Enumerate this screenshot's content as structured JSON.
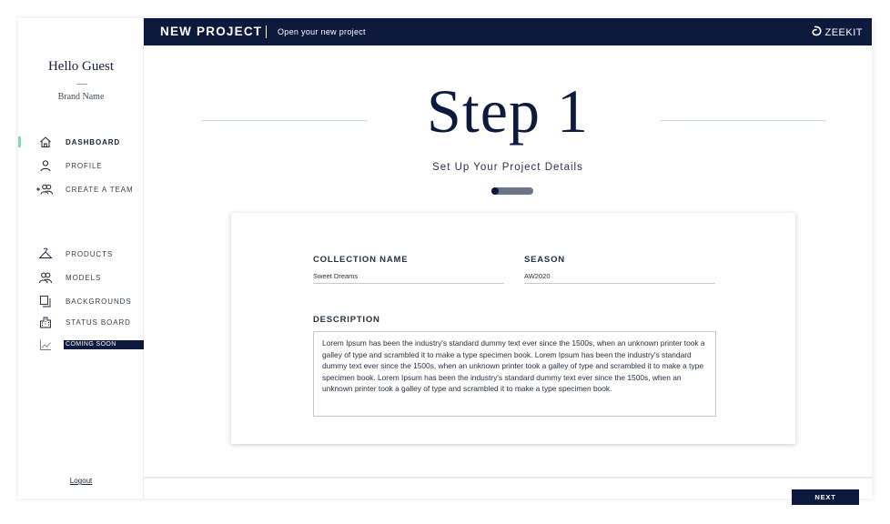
{
  "sidebar": {
    "greeting": "Hello Guest",
    "brand": "Brand Name",
    "nav_primary": [
      {
        "label": "DASHBOARD",
        "icon": "home-icon",
        "active": true
      },
      {
        "label": "PROFILE",
        "icon": "user-icon",
        "active": false
      },
      {
        "label": "CREATE A TEAM",
        "icon": "add-team-icon",
        "active": false
      }
    ],
    "nav_secondary": [
      {
        "label": "PRODUCTS",
        "icon": "hanger-icon"
      },
      {
        "label": "MODELS",
        "icon": "models-icon"
      },
      {
        "label": "BACKGROUNDS",
        "icon": "layers-icon"
      },
      {
        "label": "STATUS BOARD",
        "icon": "buildings-icon"
      },
      {
        "label": "COMING SOON",
        "icon": "chart-icon"
      }
    ],
    "logout": "Logout"
  },
  "topbar": {
    "title": "NEW PROJECT",
    "subtitle": "Open your new project",
    "logo": "ZEEKIT"
  },
  "main": {
    "step_heading": "Step 1",
    "step_subtitle": "Set Up Your Project Details",
    "progress": 0.18,
    "form": {
      "collection_label": "COLLECTION NAME",
      "collection_value": "Sweet Dreams",
      "season_label": "SEASON",
      "season_value": "AW2020",
      "description_label": "DESCRIPTION",
      "description_value": "Lorem Ipsum has been the industry's standard dummy text ever since the 1500s, when an unknown printer took a galley of type and scrambled it to make a type specimen book. Lorem Ipsum has been the industry's standard dummy text ever since the 1500s, when an unknown printer took a galley of type and scrambled it to make a type specimen book. Lorem Ipsum has been the industry's standard dummy text ever since the 1500s, when an unknown printer took a galley of type and scrambled it to make a type specimen book."
    },
    "next_label": "NEXT"
  },
  "colors": {
    "navy": "#0e1a3d",
    "accent": "#8fd3b8"
  }
}
